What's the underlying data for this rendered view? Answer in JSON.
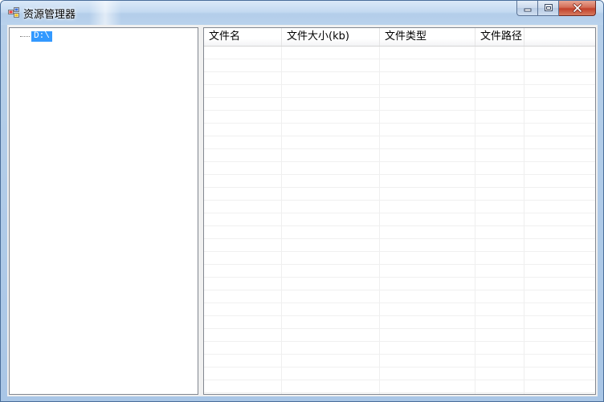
{
  "window": {
    "title": "资源管理器",
    "controls": {
      "minimize_icon": "minimize-icon",
      "maximize_icon": "maximize-icon",
      "close_icon": "close-icon"
    },
    "accent_color": "#3399ff"
  },
  "tree": {
    "nodes": [
      {
        "label": "D:\\"
      }
    ]
  },
  "list": {
    "columns": [
      {
        "label": "文件名"
      },
      {
        "label": "文件大小(kb)"
      },
      {
        "label": "文件类型"
      },
      {
        "label": "文件路径"
      }
    ],
    "rows": []
  }
}
